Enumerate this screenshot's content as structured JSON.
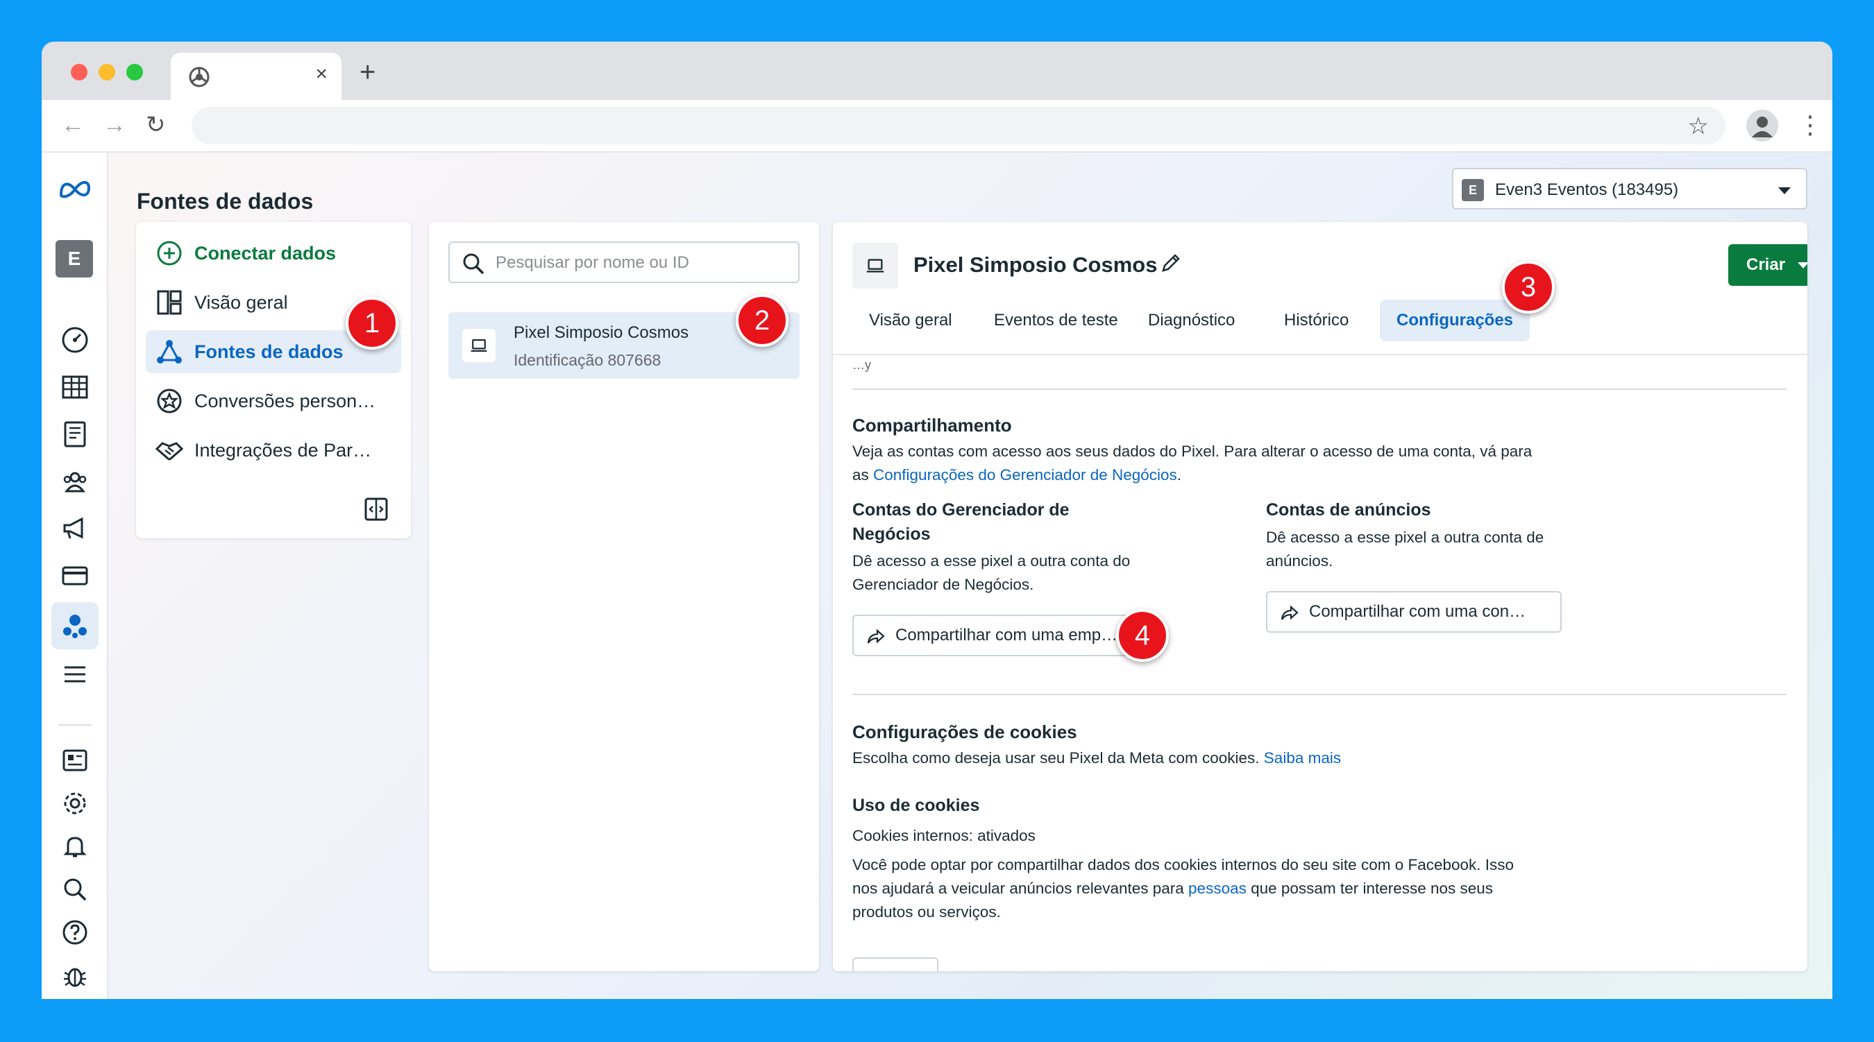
{
  "browser": {
    "tab_close": "×",
    "new_tab": "+",
    "back": "←",
    "forward": "→",
    "reload": "↻",
    "star": "☆",
    "menu": "⋮"
  },
  "header": {
    "title": "Fontes de dados",
    "account": {
      "badge": "E",
      "name": "Even3 Eventos (183495)"
    }
  },
  "rail": {
    "avatar": "E",
    "icons": [
      "meta-logo-icon",
      "dashboard-icon",
      "table-icon",
      "catalog-icon",
      "audience-icon",
      "ads-megaphone-icon",
      "billing-card-icon",
      "events-manager-icon",
      "menu-icon",
      "pages-icon",
      "settings-gear-icon",
      "notifications-bell-icon",
      "search-icon",
      "help-icon",
      "bug-icon"
    ]
  },
  "sidebar": {
    "items": [
      {
        "label": "Conectar dados",
        "icon": "plus-circle-icon"
      },
      {
        "label": "Visão geral",
        "icon": "overview-grid-icon"
      },
      {
        "label": "Fontes de dados",
        "icon": "data-sources-icon",
        "active": true
      },
      {
        "label": "Conversões person…",
        "icon": "star-badge-icon"
      },
      {
        "label": "Integrações de Par…",
        "icon": "handshake-icon"
      }
    ]
  },
  "list": {
    "search_placeholder": "Pesquisar por nome ou ID",
    "items": [
      {
        "title": "Pixel Simposio Cosmos",
        "subtitle": "Identificação 807668"
      }
    ]
  },
  "detail": {
    "title": "Pixel Simposio Cosmos",
    "create_label": "Criar",
    "tabs": [
      "Visão geral",
      "Eventos de teste",
      "Diagnóstico",
      "Histórico",
      "Configurações"
    ],
    "active_tab": "Configurações",
    "cutoff_text": "…y",
    "sharing": {
      "title": "Compartilhamento",
      "desc_line1": "Veja as contas com acesso aos seus dados do Pixel. Para alterar o acesso de uma conta, vá para",
      "desc_prefix": "as ",
      "desc_link": "Configurações do Gerenciador de Negócios",
      "desc_suffix": ".",
      "bm": {
        "title_line1": "Contas do Gerenciador de",
        "title_line2": "Negócios",
        "desc_line1": "Dê acesso a esse pixel a outra conta do",
        "desc_line2": "Gerenciador de Negócios.",
        "button": "Compartilhar com uma emp…"
      },
      "ads": {
        "title": "Contas de anúncios",
        "desc_line1": "Dê acesso a esse pixel a outra conta de",
        "desc_line2": "anúncios.",
        "button": "Compartilhar com uma con…"
      }
    },
    "cookies": {
      "title": "Configurações de cookies",
      "desc": "Escolha como deseja usar seu Pixel da Meta com cookies. ",
      "desc_link": "Saiba mais",
      "usage_title": "Uso de cookies",
      "status": "Cookies internos: ativados",
      "para_line1": "Você pode optar por compartilhar dados dos cookies internos do seu site com o Facebook. Isso",
      "para_line2_prefix": "nos ajudará a veicular anúncios relevantes para ",
      "para_line2_link": "pessoas",
      "para_line2_suffix": " que possam ter interesse nos seus",
      "para_line3": "produtos ou serviços."
    }
  },
  "annotations": [
    "1",
    "2",
    "3",
    "4"
  ],
  "colors": {
    "background": "#0d9cf7",
    "accent_blue": "#0a66c2",
    "create_green": "#0a7b3e",
    "marker_red": "#e8141c"
  }
}
